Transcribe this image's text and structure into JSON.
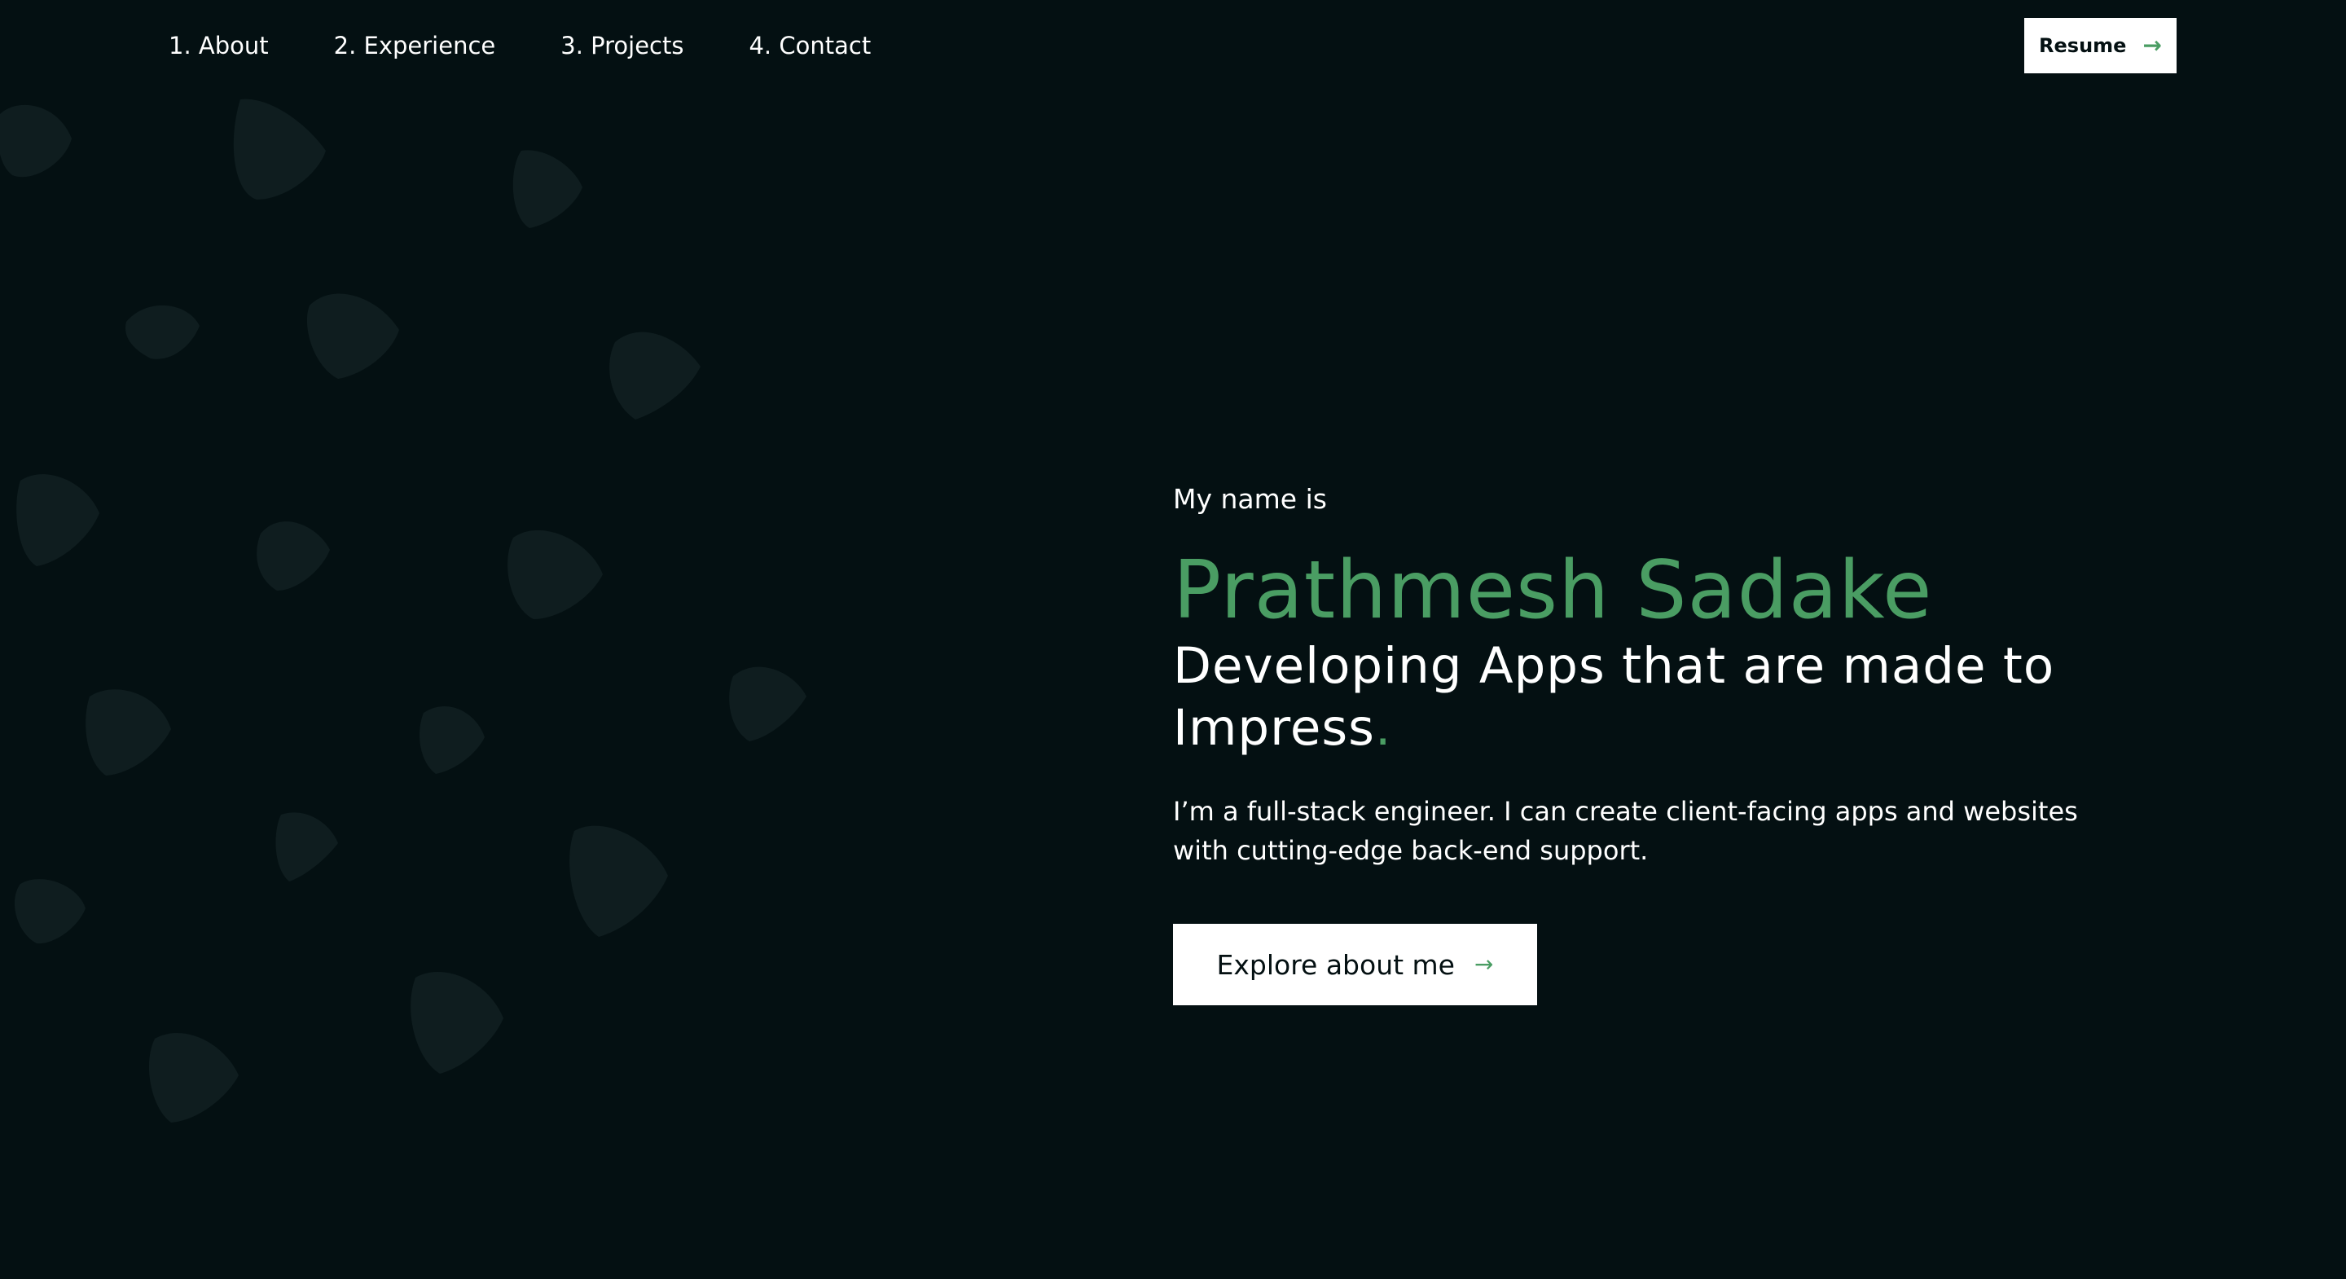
{
  "nav": {
    "items": [
      {
        "label": "1. About"
      },
      {
        "label": "2. Experience"
      },
      {
        "label": "3. Projects"
      },
      {
        "label": "4. Contact"
      }
    ],
    "resume_label": "Resume",
    "resume_arrow": "→"
  },
  "hero": {
    "intro": "My name is",
    "name": "Prathmesh Sadake",
    "tagline_line1": "Developing Apps that are made to",
    "tagline_line2": "Impress",
    "tagline_dot": ".",
    "description": "I’m a full-stack engineer. I can create client-facing apps and websites with cutting-edge back-end support.",
    "cta_label": "Explore about me",
    "cta_arrow": "→"
  },
  "colors": {
    "background": "#041012",
    "accent": "#4a9d63",
    "text": "#ffffff",
    "blob": "#0f1d1f"
  },
  "icons": {
    "resume": "arrow-right-icon",
    "cta": "arrow-right-icon"
  }
}
